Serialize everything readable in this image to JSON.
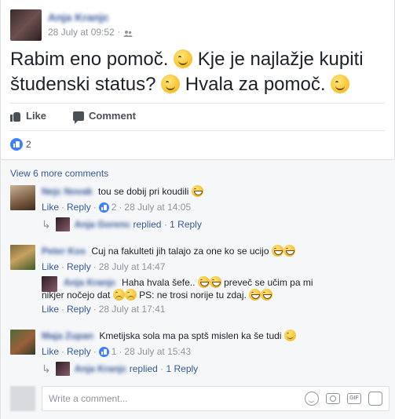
{
  "post": {
    "author": "Anja Kranjc",
    "timestamp": "28 July at 09:52",
    "audience_icon": "friends-icon",
    "text_parts": [
      "Rabim eno pomoč.",
      "Kje je najlažje kupiti študenski status?",
      "Hvala za pomoč."
    ],
    "likes_count": "2"
  },
  "actions": {
    "like_label": "Like",
    "comment_label": "Comment"
  },
  "view_more": "View 6 more comments",
  "comments": [
    {
      "author": "Nejc Novak",
      "text": "tou se dobij pri koudili",
      "like_label": "Like",
      "reply_label": "Reply",
      "likes": "2",
      "date": "28 July at 14:05",
      "reply": {
        "author": "Anja Gorenc",
        "label": "replied",
        "count": "1 Reply"
      }
    },
    {
      "author": "Peter Kos",
      "text": "Cuj na fakulteti jih talajo za one ko se ucijo",
      "like_label": "Like",
      "reply_label": "Reply",
      "date": "28 July at 14:47",
      "nested": {
        "author": "Anja Kranjc",
        "text_a": "Haha hvala šefe..",
        "text_b": "preveč se učim pa mi",
        "text_c": "nikjer nočejo dat",
        "text_d": "PS: ne trosi norije tu zdaj.",
        "like_label": "Like",
        "reply_label": "Reply",
        "date": "28 July at 17:41"
      }
    },
    {
      "author": "Maja Zupan",
      "text": "Kmetijska sola ma pa sptš mislen ka še tudi",
      "like_label": "Like",
      "reply_label": "Reply",
      "likes": "1",
      "date": "28 July at 15:43",
      "reply": {
        "author": "Anja Kranjc",
        "label": "replied",
        "count": "1 Reply"
      }
    }
  ],
  "composer": {
    "placeholder": "Write a comment...",
    "gif_label": "GIF"
  },
  "colors": {
    "link": "#365899",
    "meta": "#90949c",
    "like_blue": "#4080ff"
  }
}
